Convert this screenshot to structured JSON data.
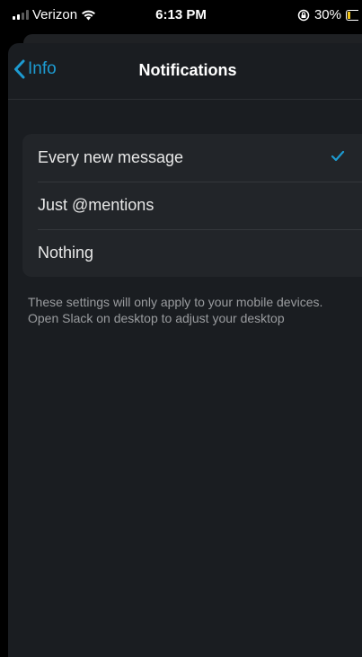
{
  "status_bar": {
    "carrier": "Verizon",
    "time": "6:13 PM",
    "battery_percent": "30%",
    "battery_level": 0.3
  },
  "nav": {
    "back_label": "Info",
    "title": "Notifications"
  },
  "options": [
    {
      "label": "Every new message",
      "selected": true
    },
    {
      "label": "Just @mentions",
      "selected": false
    },
    {
      "label": "Nothing",
      "selected": false
    }
  ],
  "footnote": "These settings will only apply to your mobile devices. Open Slack on desktop to adjust your desktop",
  "colors": {
    "accent": "#1d9bd1",
    "background": "#1a1d21",
    "group_background": "#222529",
    "battery": "#f0c419"
  }
}
